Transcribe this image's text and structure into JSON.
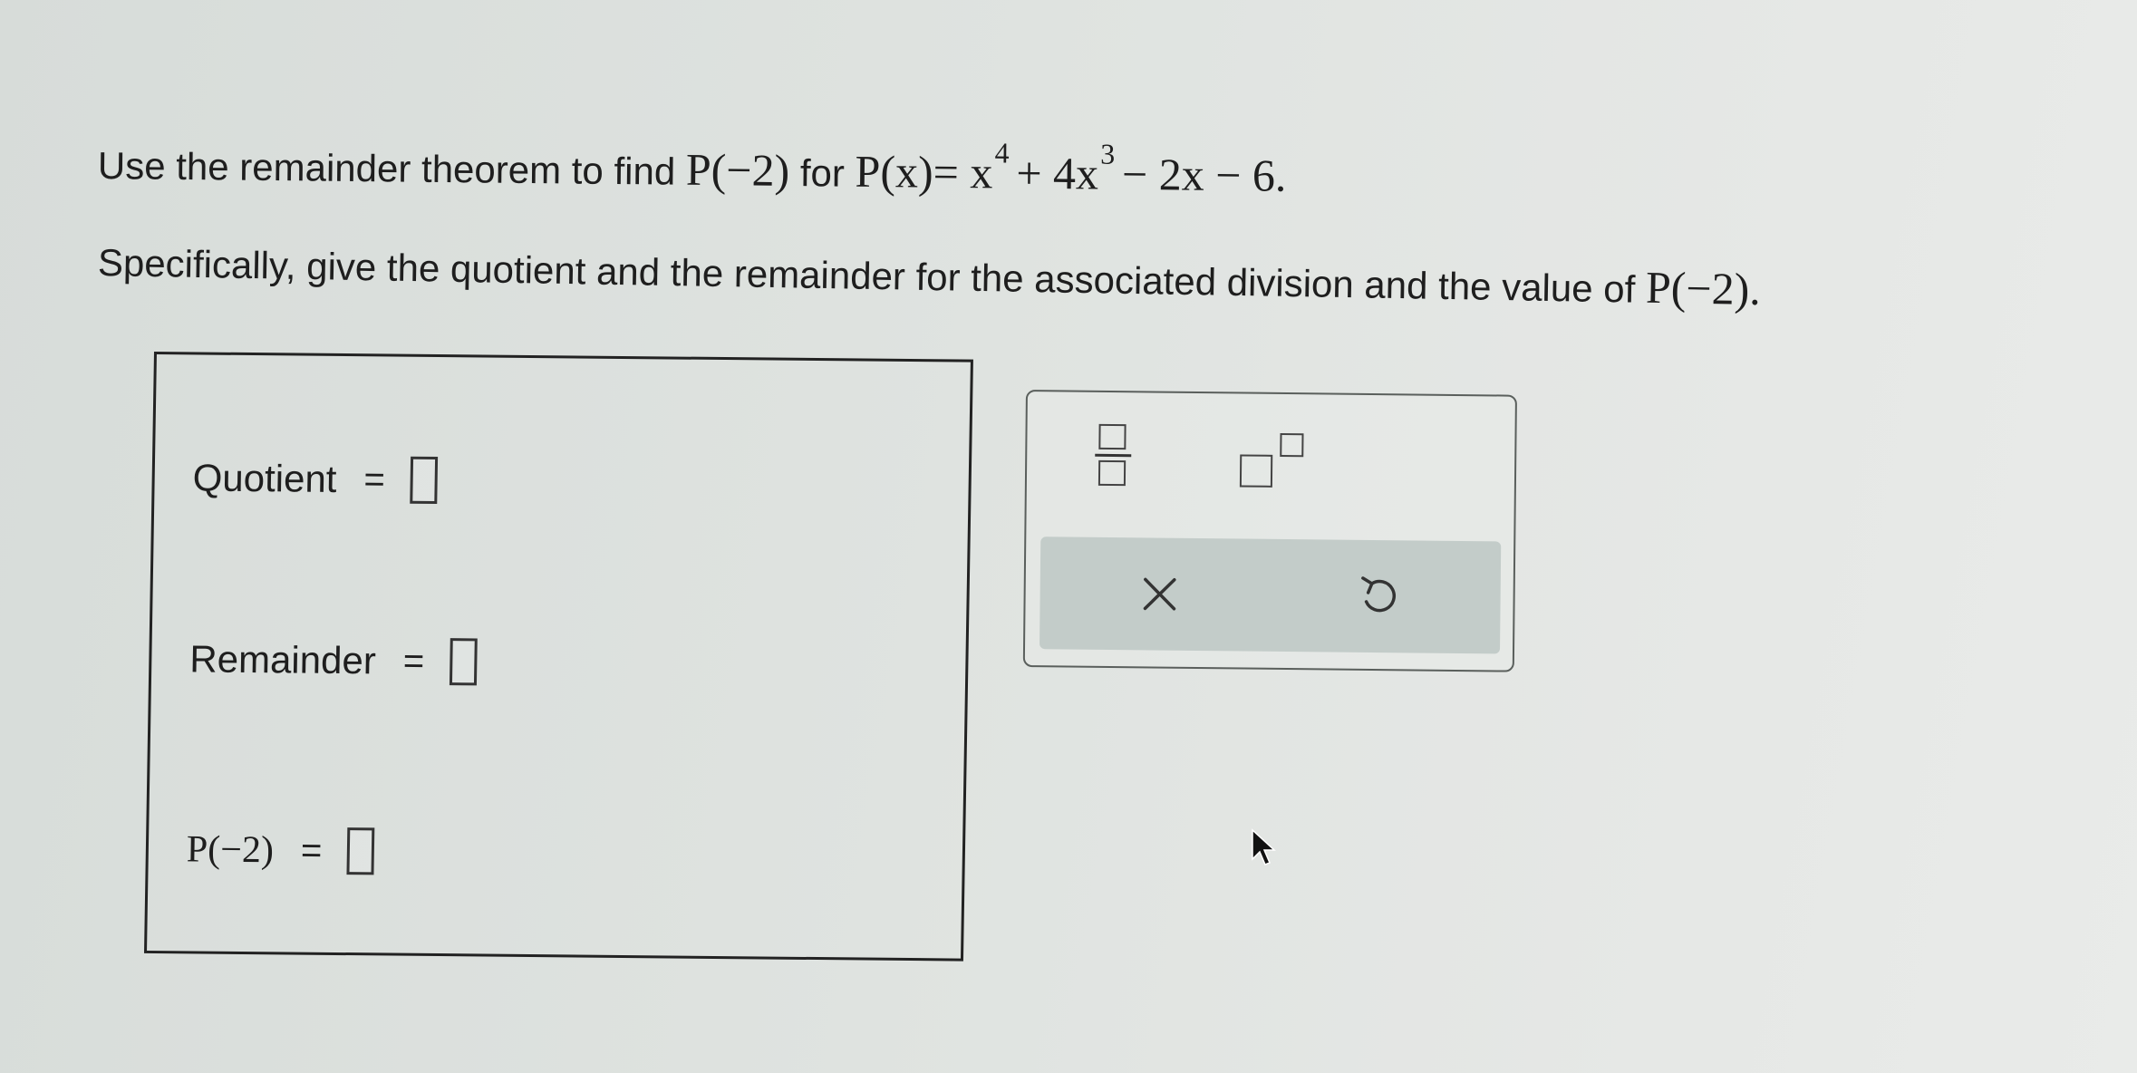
{
  "question": {
    "line1_prefix": "Use the remainder theorem to find",
    "line1_target": "P(−2)",
    "line1_for": "for",
    "line1_poly_lhs": "P(x)",
    "line1_poly_rhs": "= x",
    "exp4": "4",
    "term2": "+ 4x",
    "exp3": "3",
    "term3": "− 2x − 6.",
    "line2_text": "Specifically, give the quotient and the remainder for the associated division and the value of",
    "line2_target": "P(−2)."
  },
  "answers": {
    "quotient_label": "Quotient",
    "remainder_label": "Remainder",
    "p_label": "P(−2)",
    "equals": "=",
    "quotient_value": "",
    "remainder_value": "",
    "p_value": ""
  },
  "toolbar": {
    "fraction_icon": "fraction-icon",
    "exponent_icon": "exponent-icon",
    "clear_icon": "clear-icon",
    "undo_icon": "undo-icon"
  }
}
